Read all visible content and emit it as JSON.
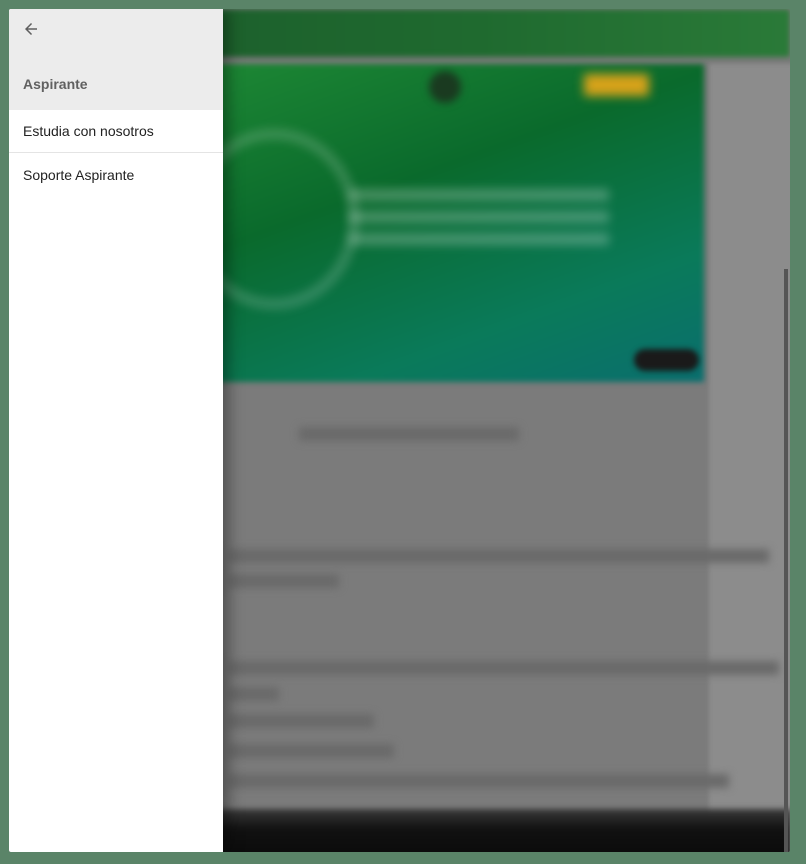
{
  "drawer": {
    "back_icon": "arrow-left-icon",
    "title": "Aspirante",
    "items": [
      {
        "label": "Estudia con nosotros"
      },
      {
        "label": "Soporte Aspirante"
      }
    ]
  },
  "colors": {
    "drawer_header_bg": "#ececec",
    "drawer_bg": "#ffffff",
    "title_color": "#616161",
    "overlay": "#7b7b7b",
    "frame": "#5a8468"
  }
}
